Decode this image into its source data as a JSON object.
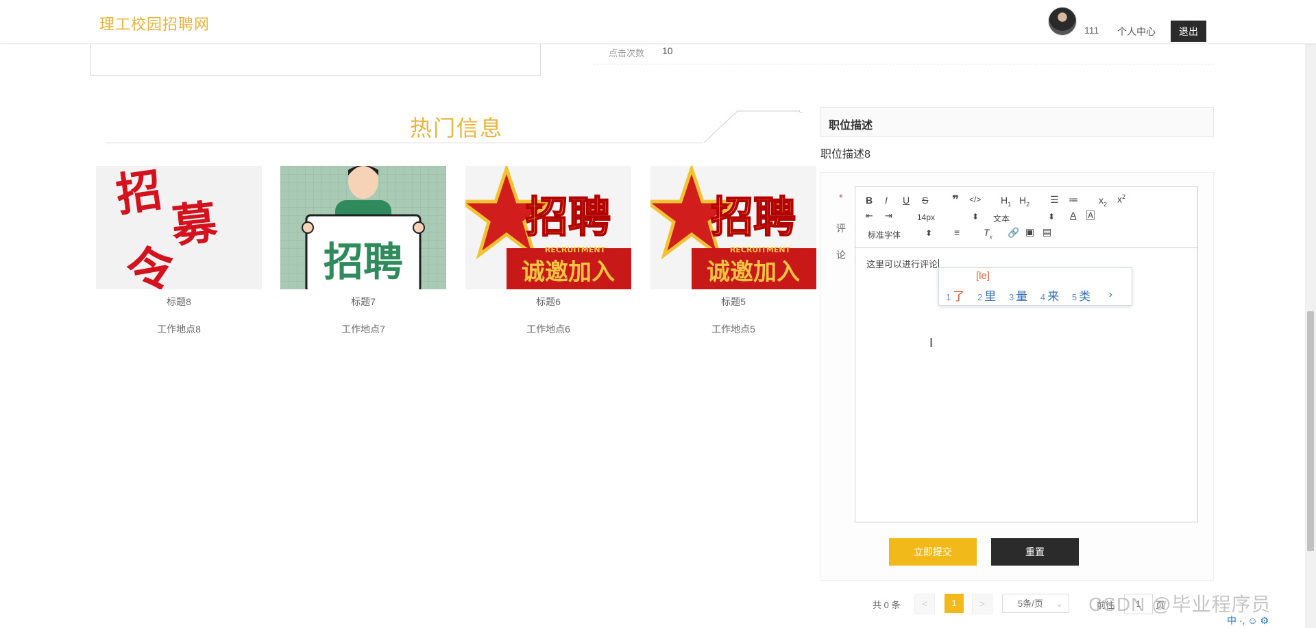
{
  "header": {
    "brand": "理工校园招聘网",
    "username": "111",
    "personal_center": "个人中心",
    "logout": "退出"
  },
  "detail": {
    "click_label": "点击次数",
    "click_value": "10"
  },
  "hot": {
    "title": "热门信息",
    "cards": [
      {
        "title": "标题8",
        "address": "工作地点8",
        "image_text": "招募令"
      },
      {
        "title": "标题7",
        "address": "工作地点7",
        "image_text": "招聘"
      },
      {
        "title": "标题6",
        "address": "工作地点6",
        "image_text": "招聘",
        "image_sub": "诚邀加入",
        "image_en": "RECRUITMENT"
      },
      {
        "title": "标题5",
        "address": "工作地点5",
        "image_text": "招聘",
        "image_sub": "诚邀加入",
        "image_en": "RECRUITMENT"
      }
    ]
  },
  "job": {
    "heading": "职位描述",
    "text": "职位描述8"
  },
  "comment": {
    "required_mark": "*",
    "label_1": "评",
    "label_2": "论",
    "font_size": "14px",
    "text_type": "文本",
    "font_family": "标准字体",
    "content": "这里可以进行评论",
    "submit": "立即提交",
    "reset": "重置"
  },
  "ime": {
    "pinyin": "[le]",
    "candidates": [
      {
        "num": "1",
        "char": "了"
      },
      {
        "num": "2",
        "char": "里"
      },
      {
        "num": "3",
        "char": "量"
      },
      {
        "num": "4",
        "char": "来"
      },
      {
        "num": "5",
        "char": "类"
      }
    ],
    "next": "›"
  },
  "pagination": {
    "total": "共 0 条",
    "prev": "<",
    "current": "1",
    "next": ">",
    "page_size": "5条/页",
    "goto": "前往",
    "goto_value": "1",
    "page_unit": "页"
  },
  "watermark": "CSDN @毕业程序员",
  "tray": "中 ·, ☺ ⚙"
}
